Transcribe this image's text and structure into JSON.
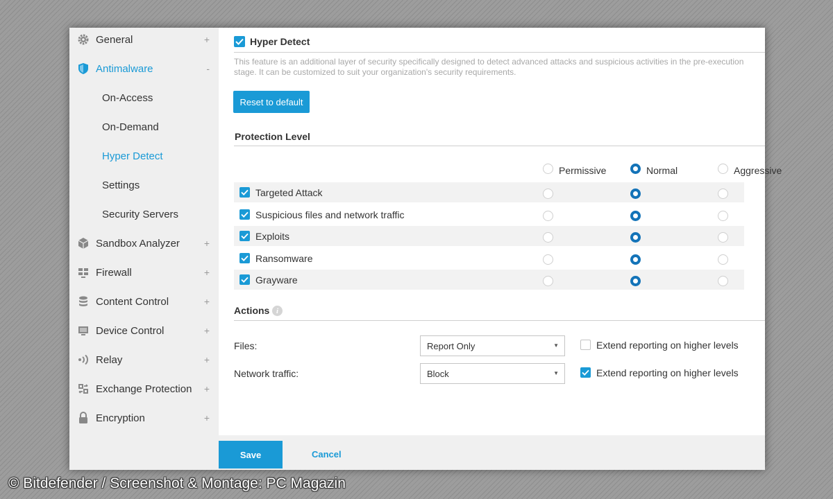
{
  "sidebar": {
    "general": "General",
    "antimalware": "Antimalware",
    "sub_items": [
      "On-Access",
      "On-Demand",
      "Hyper Detect",
      "Settings",
      "Security Servers"
    ],
    "sandbox": "Sandbox Analyzer",
    "firewall": "Firewall",
    "content_control": "Content Control",
    "device_control": "Device Control",
    "relay": "Relay",
    "exchange": "Exchange Protection",
    "encryption": "Encryption",
    "plus": "+",
    "minus": "-"
  },
  "main": {
    "feature_title": "Hyper Detect",
    "description": "This feature is an additional layer of security specifically designed to detect advanced attacks and suspicious activities in the pre-execution stage. It can be customized to suit your organization's security requirements.",
    "reset_button": "Reset to default",
    "protection_level_heading": "Protection Level",
    "levels": [
      "Permissive",
      "Normal",
      "Aggressive"
    ],
    "selected_header_level": "Normal",
    "rows": [
      {
        "label": "Targeted Attack",
        "checked": true,
        "level": "Normal"
      },
      {
        "label": "Suspicious files and network traffic",
        "checked": true,
        "level": "Normal"
      },
      {
        "label": "Exploits",
        "checked": true,
        "level": "Normal"
      },
      {
        "label": "Ransomware",
        "checked": true,
        "level": "Normal"
      },
      {
        "label": "Grayware",
        "checked": true,
        "level": "Normal"
      }
    ],
    "actions_heading": "Actions",
    "files_label": "Files:",
    "files_value": "Report Only",
    "files_extend_label": "Extend reporting on higher levels",
    "files_extend_checked": false,
    "network_label": "Network traffic:",
    "network_value": "Block",
    "network_extend_label": "Extend reporting on higher levels",
    "network_extend_checked": true
  },
  "footer": {
    "save": "Save",
    "cancel": "Cancel"
  },
  "watermark": "© Bitdefender / Screenshot & Montage: PC Magazin",
  "colors": {
    "accent": "#1a9ad6",
    "radio_selected": "#1373b8"
  }
}
